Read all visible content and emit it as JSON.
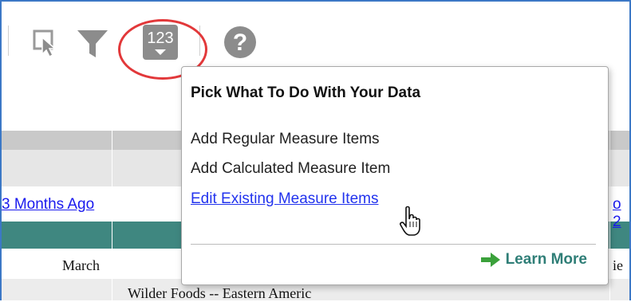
{
  "toolbar": {
    "icons": [
      "select-cursor-icon",
      "filter-icon",
      "measure-123-icon",
      "help-icon"
    ],
    "measure_badge": "123",
    "help_glyph": "?",
    "highlight_color": "#e2383a"
  },
  "table": {
    "header_link_left": "3 Months Ago",
    "header_link_right": "o 2",
    "row_month": "March",
    "row_right_fragment": "ie",
    "row_company": "Wilder Foods -- Eastern Americ",
    "accent_color": "#3f8780"
  },
  "popup": {
    "title": "Pick What To Do With Your Data",
    "items": [
      {
        "label": "Add Regular Measure Items"
      },
      {
        "label": "Add Calculated Measure Item"
      },
      {
        "label": "Edit Existing Measure Items"
      }
    ],
    "learn_more": "Learn More",
    "link_color": "#2233ee",
    "learn_color": "#2f7e77"
  }
}
